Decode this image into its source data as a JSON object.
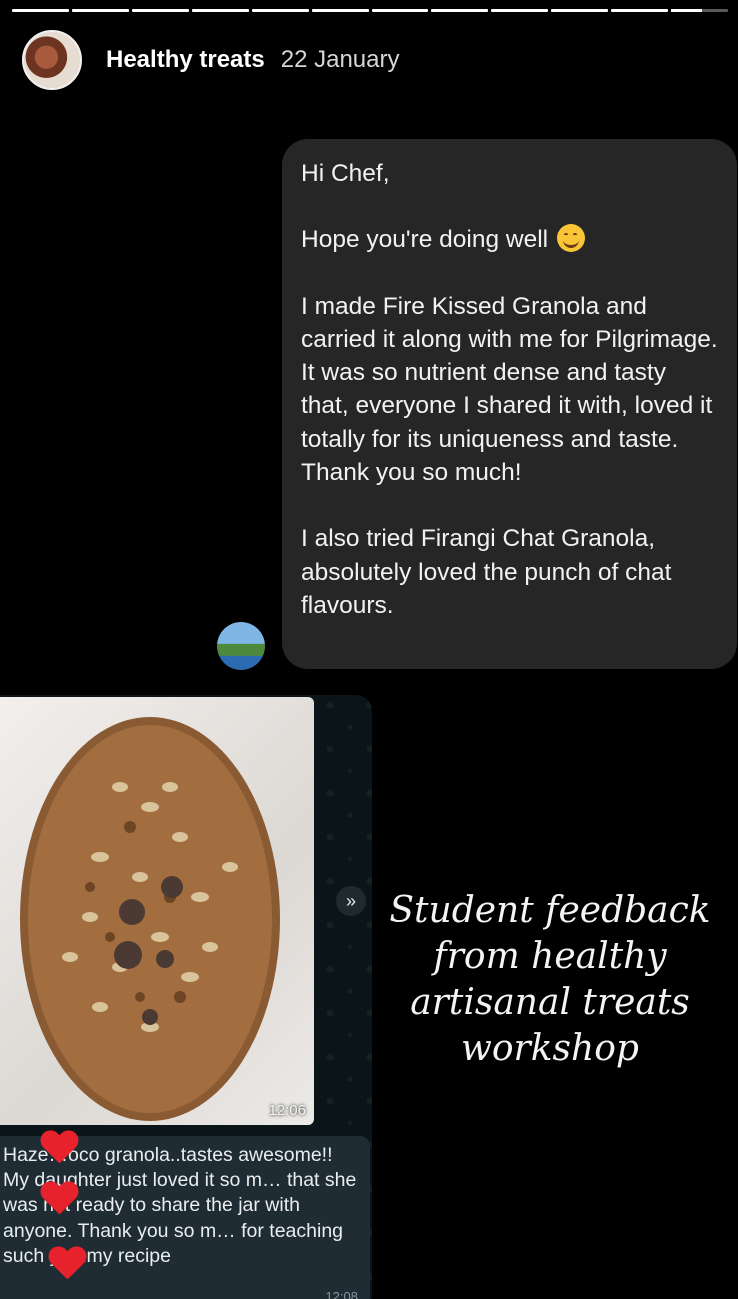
{
  "story": {
    "segments": 12,
    "active_progress": 0.55
  },
  "header": {
    "account_name": "Healthy treats",
    "date": "22 January"
  },
  "message": {
    "greeting": "Hi Chef,",
    "line2": "Hope you're doing well",
    "para1": "I made Fire Kissed Granola and carried it along with me for Pilgrimage. It was so nutrient dense and tasty that, everyone I shared it with, loved it totally for its uniqueness and taste. Thank you so much!",
    "para2": "I also tried Firangi Chat Granola, absolutely loved the punch of chat flavours."
  },
  "whatsapp": {
    "photo_time": "12:06",
    "forward_icon": "»",
    "text": "Haze…oco granola..tastes awesome!! My daughter just loved it so m… that she was not ready to share the jar with anyone. Thank you so m… for teaching such yummy recipe",
    "msg_time": "12:08"
  },
  "caption": "Student feedback from healthy artisanal treats workshop",
  "colors": {
    "bubble": "#262626",
    "heart": "#e8222c",
    "wa_bubble": "#1f2c33"
  }
}
